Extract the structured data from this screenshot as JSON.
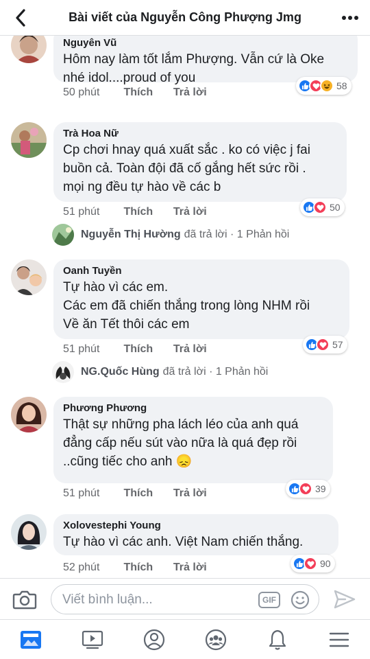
{
  "header": {
    "title": "Bài viết của Nguyễn Công Phượng Jmg"
  },
  "comments": [
    {
      "name": "Nguyên Vũ",
      "text": "Hôm nay làm tốt lắm Phượng. Vẫn cứ là Oke\nnhé idol....proud of you",
      "time": "50 phút",
      "like_label": "Thích",
      "reply_label": "Trả lời",
      "reaction_count": "58",
      "reactions": [
        "like",
        "love",
        "haha"
      ]
    },
    {
      "name": "Trà Hoa Nữ",
      "text": "Cp chơi hnay quá xuất sắc . ko có việc j fai\nbuồn cả. Toàn đội đã cố gắng hết sức rồi .\nmọi ng đều tự hào về các b",
      "time": "51 phút",
      "like_label": "Thích",
      "reply_label": "Trả lời",
      "reaction_count": "50",
      "reactions": [
        "like",
        "love"
      ],
      "reply": {
        "name": "Nguyễn Thị Hường",
        "summary": "đã trả lời · 1 Phản hồi"
      }
    },
    {
      "name": "Oanh Tuyền",
      "text": "Tự hào vì các em.\nCác em đã chiến thắng trong lòng NHM rồi\nVề ăn Tết thôi các em",
      "time": "51 phút",
      "like_label": "Thích",
      "reply_label": "Trả lời",
      "reaction_count": "57",
      "reactions": [
        "like",
        "love"
      ],
      "reply": {
        "name": "NG.Quốc Hùng",
        "summary": "đã trả lời · 1 Phản hồi"
      }
    },
    {
      "name": "Phương Phương",
      "text": "Thật sự những pha lách léo của anh quá\nđẳng cấp nếu sút vào nữa là quá đẹp rồi\n..cũng tiếc cho anh 😞",
      "time": "51 phút",
      "like_label": "Thích",
      "reply_label": "Trả lời",
      "reaction_count": "39",
      "reactions": [
        "like",
        "love"
      ]
    },
    {
      "name": "Xolovestephi Young",
      "text": "Tự hào vì các anh. Việt Nam chiến thắng.",
      "time": "52 phút",
      "like_label": "Thích",
      "reply_label": "Trả lời",
      "reaction_count": "90",
      "reactions": [
        "like",
        "love"
      ]
    }
  ],
  "composer": {
    "placeholder": "Viết bình luận...",
    "gif_label": "GIF"
  },
  "tabs": [
    "feed-icon",
    "video-icon",
    "profile-icon",
    "groups-icon",
    "notifications-icon",
    "menu-icon"
  ],
  "colors": {
    "brand": "#1877f2",
    "like": "#1877f2",
    "love": "#f33e58",
    "haha": "#f7b125",
    "bubble": "#f0f2f5",
    "meta": "#65676b"
  }
}
